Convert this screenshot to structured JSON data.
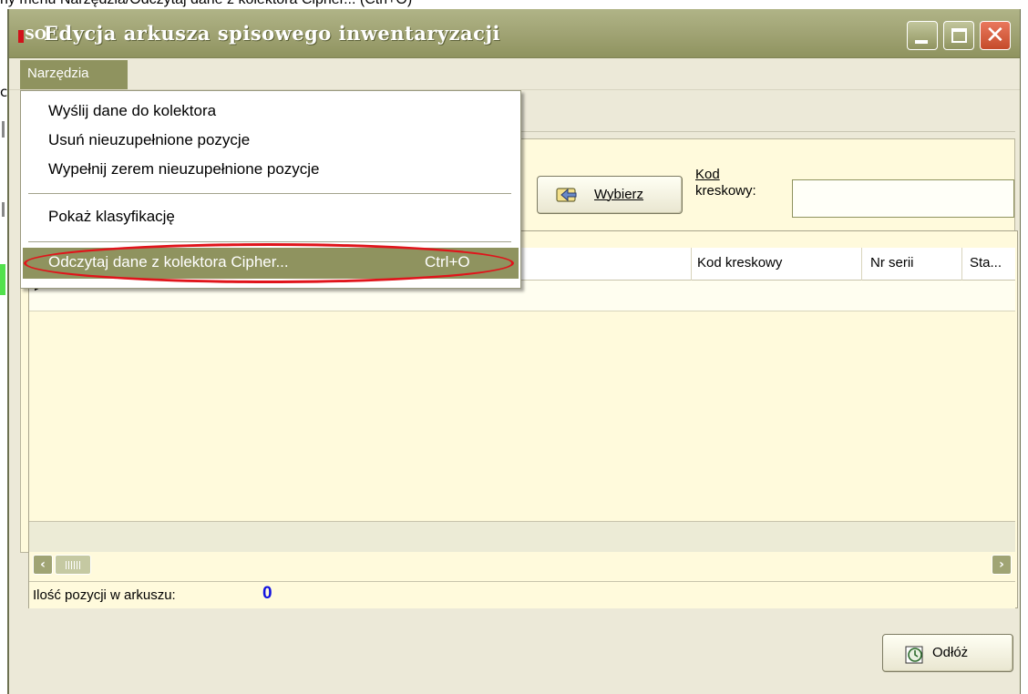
{
  "caption": "ny menu Narzędzia/Odczytaj dane z kolektora Cipher... (Ctrl+O)",
  "window": {
    "logo_text": "SO",
    "title": "Edycja arkusza spisowego inwentaryzacji"
  },
  "menubar": {
    "menu_label": "Narzędzia"
  },
  "dropdown": {
    "items": [
      {
        "label": "Wyślij dane do kolektora"
      },
      {
        "label": "Usuń nieuzupełnione pozycje"
      },
      {
        "label": "Wypełnij zerem nieuzupełnione pozycje"
      },
      {
        "label": "Pokaż klasyfikację"
      }
    ],
    "highlighted": {
      "label": "Odczytaj dane z kolektora Cipher...",
      "shortcut": "Ctrl+O"
    },
    "highlight_color": "#8f935f",
    "annotation_color": "#e0141b"
  },
  "toolbar": {
    "select_button_label": "Wybierz",
    "barcode_label_line1": "Kod",
    "barcode_label_line2": "kreskowy:",
    "barcode_value": ""
  },
  "grid": {
    "columns": [
      "Kod kreskowy",
      "Nr serii",
      "Sta..."
    ],
    "rows": [
      {
        "kod_kreskowy": "",
        "nr_serii": "",
        "stan": ""
      }
    ]
  },
  "status": {
    "label": "Ilość pozycji w arkuszu:",
    "count": "0"
  },
  "footer": {
    "postpone_button_label": "Odłóż"
  },
  "colors": {
    "titlebar": "#a2a576",
    "panel_background": "#fffadc",
    "count_color": "#1212e0"
  },
  "icons": [
    "app-logo",
    "minimize-icon",
    "maximize-icon",
    "close-icon",
    "select-hand-icon",
    "scroll-left-icon",
    "scroll-right-icon",
    "clock-icon"
  ]
}
